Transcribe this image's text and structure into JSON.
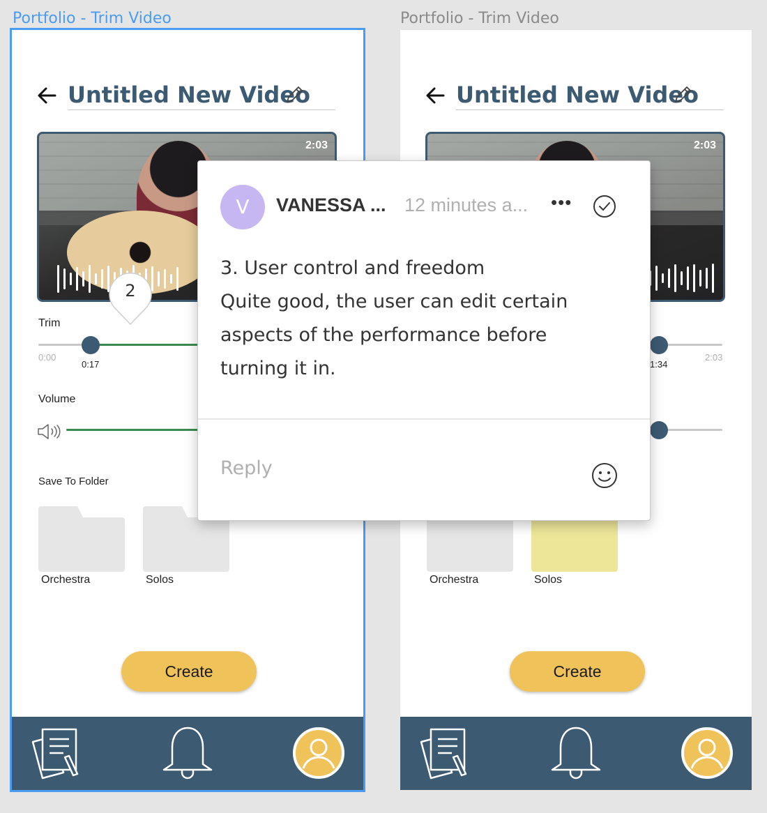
{
  "frames": [
    {
      "frame_label": "Portfolio - Trim Video",
      "title": "Untitled New Video",
      "video_duration": "2:03",
      "trim_label": "Trim",
      "trim_start": "0:00",
      "trim_handle_time": "0:17",
      "volume_label": "Volume",
      "save_folder_label": "Save To Folder",
      "folders": [
        "Orchestra",
        "Solos"
      ],
      "create_label": "Create",
      "comment_pin_number": "2"
    },
    {
      "frame_label": "Portfolio - Trim Video",
      "title": "Untitled New Video",
      "video_duration": "2:03",
      "trim_handle_time": "1:34",
      "trim_end": "2:03",
      "folders": [
        "Orchestra",
        "Solos"
      ],
      "create_label": "Create"
    }
  ],
  "comment": {
    "avatar_initial": "V",
    "author": "VANESSA ...",
    "timestamp": "12 minutes a...",
    "more": "•••",
    "body_lines": [
      "3. User control and freedom",
      "Quite good, the user can edit certain",
      "aspects of the performance before",
      "turning it in."
    ],
    "reply_placeholder": "Reply"
  },
  "icons": {
    "back": "arrow-left-icon",
    "edit": "pencil-icon",
    "volume": "speaker-icon",
    "resolve": "check-circle-icon",
    "emoji": "smiley-icon",
    "tabs": [
      "document-pen-icon",
      "bell-icon",
      "user-avatar-icon"
    ]
  },
  "colors": {
    "selection": "#4b9cf0",
    "primary": "#3d5a73",
    "accent": "#f0c35a",
    "trim_fill": "#3d8a4f",
    "folder_selected": "#ede699",
    "folder_default": "#e6e6e6",
    "avatar": "#c6b7f2"
  }
}
